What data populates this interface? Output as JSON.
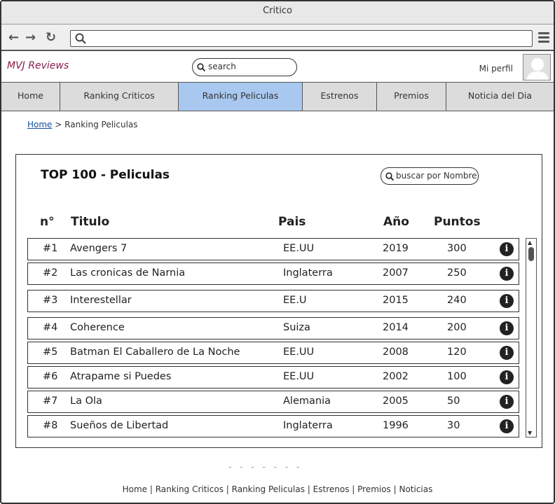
{
  "window": {
    "title": "Critico"
  },
  "browser": {
    "back_icon": "arrow-left-icon",
    "forward_icon": "arrow-right-icon",
    "reload_icon": "reload-icon",
    "address_value": ""
  },
  "header": {
    "logo": "MVJ Reviews",
    "search_placeholder": "search",
    "profile_label": "Mi perfil"
  },
  "tabs": [
    {
      "label": "Home",
      "active": false
    },
    {
      "label": "Ranking Criticos",
      "active": false
    },
    {
      "label": "Ranking Peliculas",
      "active": true
    },
    {
      "label": "Estrenos",
      "active": false
    },
    {
      "label": "Premios",
      "active": false
    },
    {
      "label": "Noticia del Dia",
      "active": false
    }
  ],
  "breadcrumb": {
    "home": "Home",
    "separator": ">",
    "current": "Ranking Peliculas"
  },
  "panel": {
    "title": "TOP 100 - Peliculas",
    "search_placeholder": "buscar por Nombre",
    "columns": [
      "n°",
      "Titulo",
      "Pais",
      "Año",
      "Puntos"
    ]
  },
  "movies": [
    {
      "rank": "#1",
      "title": "Avengers 7",
      "country": "EE.UU",
      "year": "2019",
      "points": "300"
    },
    {
      "rank": "#2",
      "title": "Las cronicas de Narnia",
      "country": "Inglaterra",
      "year": "2007",
      "points": "250"
    },
    {
      "rank": "#3",
      "title": "Interestellar",
      "country": "EE.U",
      "year": "2015",
      "points": "240"
    },
    {
      "rank": "#4",
      "title": "Coherence",
      "country": "Suiza",
      "year": "2014",
      "points": "200"
    },
    {
      "rank": "#5",
      "title": "Batman El Caballero de La Noche",
      "country": "EE.UU",
      "year": "2008",
      "points": "120"
    },
    {
      "rank": "#6",
      "title": "Atrapame si Puedes",
      "country": "EE.UU",
      "year": "2002",
      "points": "100"
    },
    {
      "rank": "#7",
      "title": "La Ola",
      "country": "Alemania",
      "year": "2005",
      "points": "50"
    },
    {
      "rank": "#8",
      "title": "Sueños de Libertad",
      "country": "Inglaterra",
      "year": "1996",
      "points": "30"
    }
  ],
  "footer": {
    "dashes": "- - - - - - -",
    "links": "Home | Ranking Criticos | Ranking Peliculas | Estrenos | Premios | Noticias"
  },
  "colors": {
    "logo": "#8b1e4e",
    "active_tab": "#a8c8f0",
    "tab_bg": "#dcdcdc"
  }
}
